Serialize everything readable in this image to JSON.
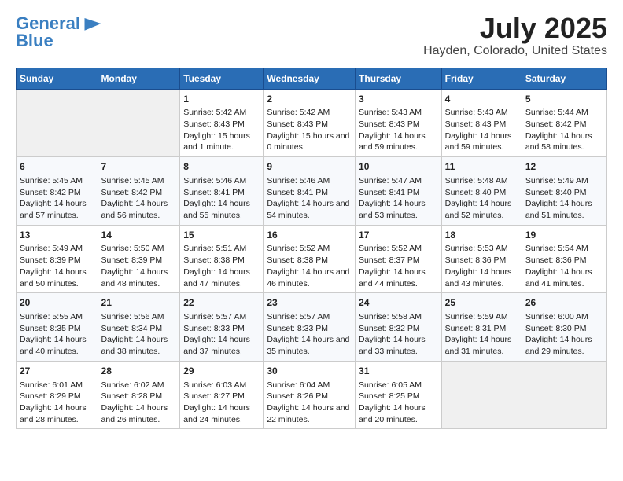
{
  "header": {
    "logo_line1": "General",
    "logo_line2": "Blue",
    "title": "July 2025",
    "subtitle": "Hayden, Colorado, United States"
  },
  "days_of_week": [
    "Sunday",
    "Monday",
    "Tuesday",
    "Wednesday",
    "Thursday",
    "Friday",
    "Saturday"
  ],
  "weeks": [
    [
      {
        "num": "",
        "info": ""
      },
      {
        "num": "",
        "info": ""
      },
      {
        "num": "1",
        "info": "Sunrise: 5:42 AM\nSunset: 8:43 PM\nDaylight: 15 hours and 1 minute."
      },
      {
        "num": "2",
        "info": "Sunrise: 5:42 AM\nSunset: 8:43 PM\nDaylight: 15 hours and 0 minutes."
      },
      {
        "num": "3",
        "info": "Sunrise: 5:43 AM\nSunset: 8:43 PM\nDaylight: 14 hours and 59 minutes."
      },
      {
        "num": "4",
        "info": "Sunrise: 5:43 AM\nSunset: 8:43 PM\nDaylight: 14 hours and 59 minutes."
      },
      {
        "num": "5",
        "info": "Sunrise: 5:44 AM\nSunset: 8:42 PM\nDaylight: 14 hours and 58 minutes."
      }
    ],
    [
      {
        "num": "6",
        "info": "Sunrise: 5:45 AM\nSunset: 8:42 PM\nDaylight: 14 hours and 57 minutes."
      },
      {
        "num": "7",
        "info": "Sunrise: 5:45 AM\nSunset: 8:42 PM\nDaylight: 14 hours and 56 minutes."
      },
      {
        "num": "8",
        "info": "Sunrise: 5:46 AM\nSunset: 8:41 PM\nDaylight: 14 hours and 55 minutes."
      },
      {
        "num": "9",
        "info": "Sunrise: 5:46 AM\nSunset: 8:41 PM\nDaylight: 14 hours and 54 minutes."
      },
      {
        "num": "10",
        "info": "Sunrise: 5:47 AM\nSunset: 8:41 PM\nDaylight: 14 hours and 53 minutes."
      },
      {
        "num": "11",
        "info": "Sunrise: 5:48 AM\nSunset: 8:40 PM\nDaylight: 14 hours and 52 minutes."
      },
      {
        "num": "12",
        "info": "Sunrise: 5:49 AM\nSunset: 8:40 PM\nDaylight: 14 hours and 51 minutes."
      }
    ],
    [
      {
        "num": "13",
        "info": "Sunrise: 5:49 AM\nSunset: 8:39 PM\nDaylight: 14 hours and 50 minutes."
      },
      {
        "num": "14",
        "info": "Sunrise: 5:50 AM\nSunset: 8:39 PM\nDaylight: 14 hours and 48 minutes."
      },
      {
        "num": "15",
        "info": "Sunrise: 5:51 AM\nSunset: 8:38 PM\nDaylight: 14 hours and 47 minutes."
      },
      {
        "num": "16",
        "info": "Sunrise: 5:52 AM\nSunset: 8:38 PM\nDaylight: 14 hours and 46 minutes."
      },
      {
        "num": "17",
        "info": "Sunrise: 5:52 AM\nSunset: 8:37 PM\nDaylight: 14 hours and 44 minutes."
      },
      {
        "num": "18",
        "info": "Sunrise: 5:53 AM\nSunset: 8:36 PM\nDaylight: 14 hours and 43 minutes."
      },
      {
        "num": "19",
        "info": "Sunrise: 5:54 AM\nSunset: 8:36 PM\nDaylight: 14 hours and 41 minutes."
      }
    ],
    [
      {
        "num": "20",
        "info": "Sunrise: 5:55 AM\nSunset: 8:35 PM\nDaylight: 14 hours and 40 minutes."
      },
      {
        "num": "21",
        "info": "Sunrise: 5:56 AM\nSunset: 8:34 PM\nDaylight: 14 hours and 38 minutes."
      },
      {
        "num": "22",
        "info": "Sunrise: 5:57 AM\nSunset: 8:33 PM\nDaylight: 14 hours and 37 minutes."
      },
      {
        "num": "23",
        "info": "Sunrise: 5:57 AM\nSunset: 8:33 PM\nDaylight: 14 hours and 35 minutes."
      },
      {
        "num": "24",
        "info": "Sunrise: 5:58 AM\nSunset: 8:32 PM\nDaylight: 14 hours and 33 minutes."
      },
      {
        "num": "25",
        "info": "Sunrise: 5:59 AM\nSunset: 8:31 PM\nDaylight: 14 hours and 31 minutes."
      },
      {
        "num": "26",
        "info": "Sunrise: 6:00 AM\nSunset: 8:30 PM\nDaylight: 14 hours and 29 minutes."
      }
    ],
    [
      {
        "num": "27",
        "info": "Sunrise: 6:01 AM\nSunset: 8:29 PM\nDaylight: 14 hours and 28 minutes."
      },
      {
        "num": "28",
        "info": "Sunrise: 6:02 AM\nSunset: 8:28 PM\nDaylight: 14 hours and 26 minutes."
      },
      {
        "num": "29",
        "info": "Sunrise: 6:03 AM\nSunset: 8:27 PM\nDaylight: 14 hours and 24 minutes."
      },
      {
        "num": "30",
        "info": "Sunrise: 6:04 AM\nSunset: 8:26 PM\nDaylight: 14 hours and 22 minutes."
      },
      {
        "num": "31",
        "info": "Sunrise: 6:05 AM\nSunset: 8:25 PM\nDaylight: 14 hours and 20 minutes."
      },
      {
        "num": "",
        "info": ""
      },
      {
        "num": "",
        "info": ""
      }
    ]
  ]
}
